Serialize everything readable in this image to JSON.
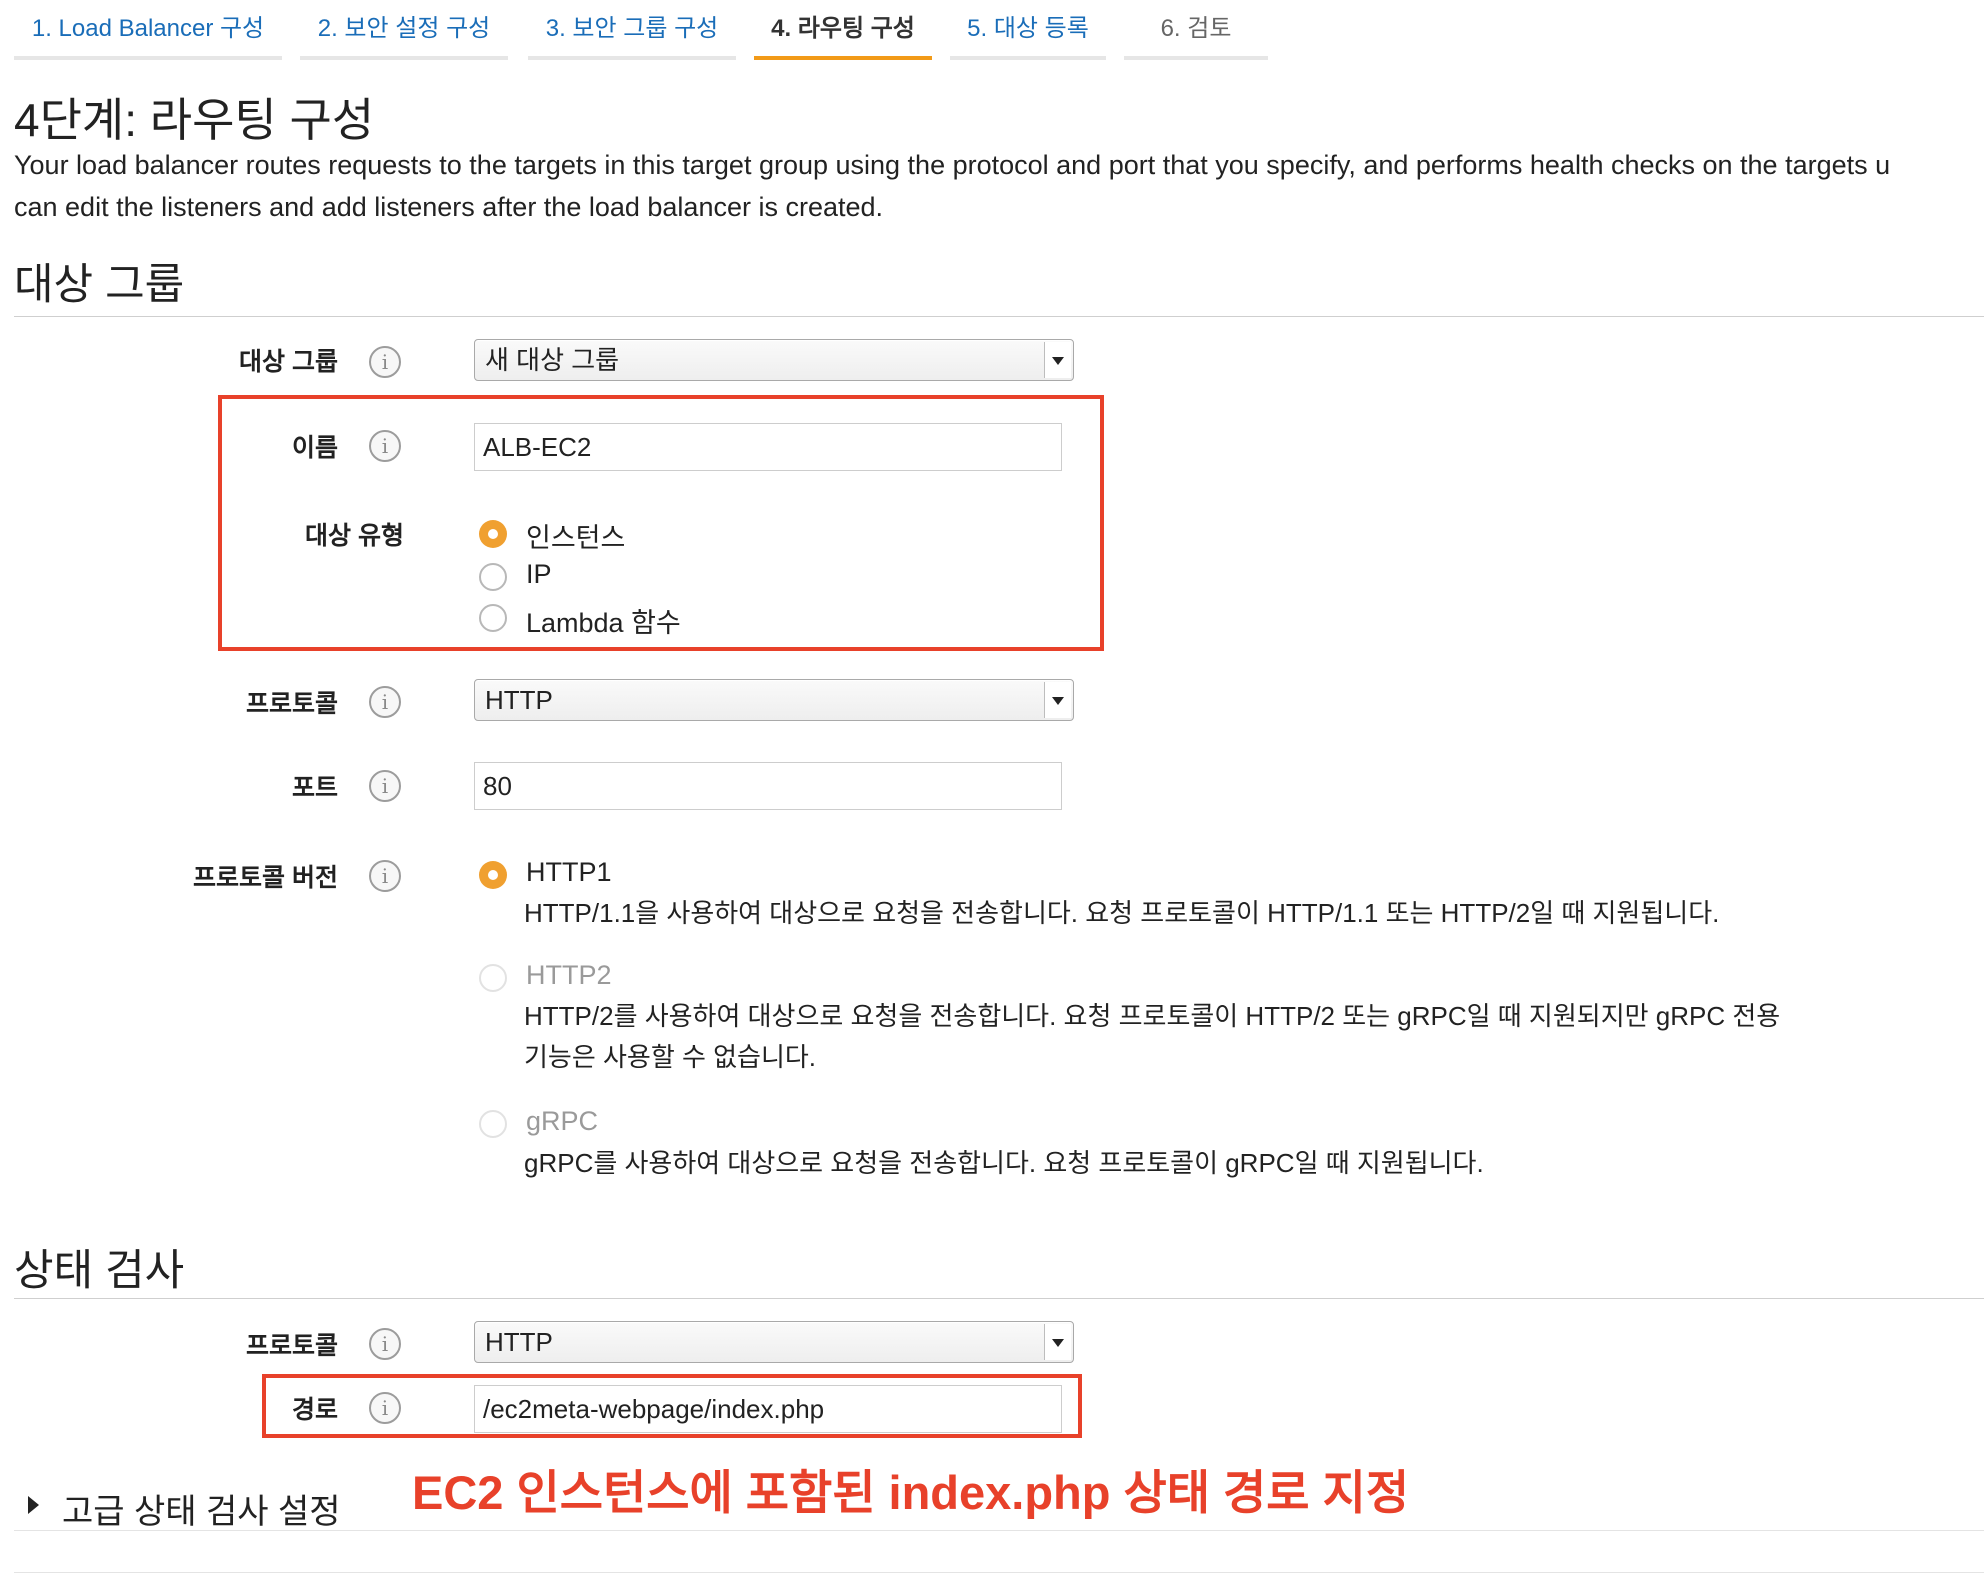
{
  "wizard": {
    "tabs": [
      {
        "label": "1. Load Balancer 구성",
        "state": "link"
      },
      {
        "label": "2. 보안 설정 구성",
        "state": "link"
      },
      {
        "label": "3. 보안 그룹 구성",
        "state": "link"
      },
      {
        "label": "4. 라우팅 구성",
        "state": "active"
      },
      {
        "label": "5. 대상 등록",
        "state": "link"
      },
      {
        "label": "6. 검토",
        "state": "disabled"
      }
    ]
  },
  "page": {
    "title": "4단계: 라우팅 구성",
    "intro_line1": "Your load balancer routes requests to the targets in this target group using the protocol and port that you specify, and performs health checks on the targets u",
    "intro_line2": "can edit the listeners and add listeners after the load balancer is created."
  },
  "target_group": {
    "section_title": "대상 그룹",
    "group_label": "대상 그룹",
    "group_value": "새 대상 그룹",
    "name_label": "이름",
    "name_value": "ALB-EC2",
    "target_type_label": "대상 유형",
    "target_types": [
      {
        "label": "인스턴스",
        "selected": true
      },
      {
        "label": "IP",
        "selected": false
      },
      {
        "label": "Lambda 함수",
        "selected": false
      }
    ],
    "protocol_label": "프로토콜",
    "protocol_value": "HTTP",
    "port_label": "포트",
    "port_value": "80",
    "protocol_version_label": "프로토콜 버전",
    "protocol_versions": [
      {
        "label": "HTTP1",
        "selected": true,
        "enabled": true,
        "desc_line1": "HTTP/1.1을 사용하여 대상으로 요청을 전송합니다. 요청 프로토콜이 HTTP/1.1 또는 HTTP/2일 때 지원됩니다.",
        "desc_line2": ""
      },
      {
        "label": "HTTP2",
        "selected": false,
        "enabled": false,
        "desc_line1": "HTTP/2를 사용하여 대상으로 요청을 전송합니다. 요청 프로토콜이 HTTP/2 또는 gRPC일 때 지원되지만 gRPC 전용",
        "desc_line2": "기능은 사용할 수 없습니다."
      },
      {
        "label": "gRPC",
        "selected": false,
        "enabled": false,
        "desc_line1": "gRPC를 사용하여 대상으로 요청을 전송합니다. 요청 프로토콜이 gRPC일 때 지원됩니다.",
        "desc_line2": ""
      }
    ]
  },
  "health_check": {
    "section_title": "상태 검사",
    "protocol_label": "프로토콜",
    "protocol_value": "HTTP",
    "path_label": "경로",
    "path_value": "/ec2meta-webpage/index.php",
    "advanced_label": "고급 상태 검사 설정"
  },
  "annotation": {
    "text": "EC2 인스턴스에 포함된 index.php 상태 경로 지정",
    "color": "#e8412a"
  },
  "icons": {
    "info": "i",
    "accent": "#f29a18",
    "link": "#1a6db8"
  }
}
